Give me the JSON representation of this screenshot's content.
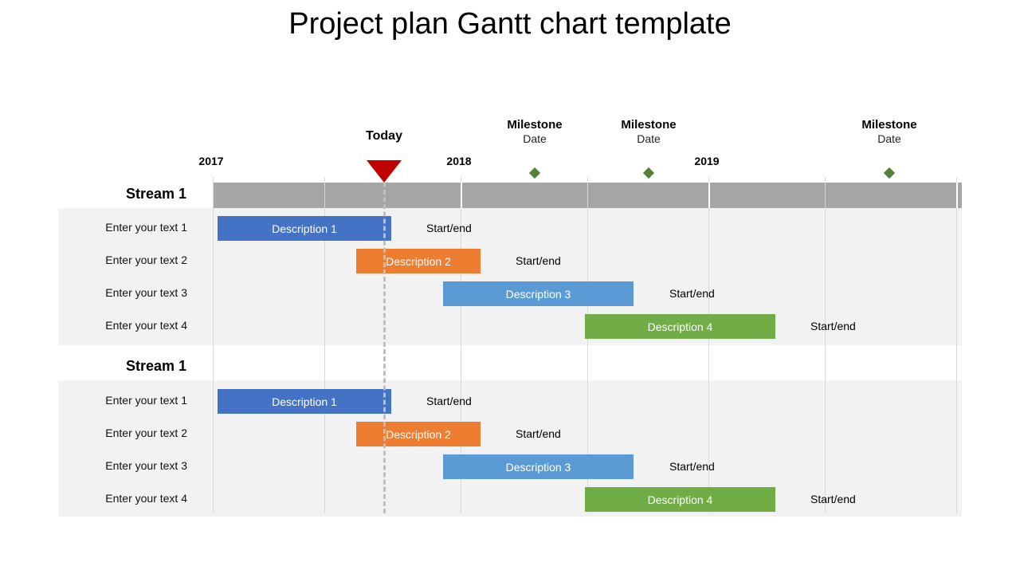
{
  "title": "Project plan Gantt chart template",
  "chart_data": {
    "type": "gantt",
    "title": "Project plan Gantt chart template",
    "x_range": [
      2017.0,
      2020.0
    ],
    "year_ticks": [
      {
        "label": "2017",
        "value": 2017.0
      },
      {
        "label": "2018",
        "value": 2018.0
      },
      {
        "label": "2019",
        "value": 2019.0
      }
    ],
    "gridlines": [
      2017.0,
      2017.45,
      2018.0,
      2018.51,
      2019.0,
      2019.47,
      2020.0
    ],
    "today": {
      "label": "Today",
      "value": 2017.69,
      "color": "#c00000"
    },
    "milestones": [
      {
        "title": "Milestone",
        "subtitle": "Date",
        "value": 2018.3
      },
      {
        "title": "Milestone",
        "subtitle": "Date",
        "value": 2018.76
      },
      {
        "title": "Milestone",
        "subtitle": "Date",
        "value": 2019.73
      }
    ],
    "milestone_color": "#538135",
    "streams": [
      {
        "label": "Stream 1",
        "tasks": [
          {
            "row_label": "Enter your text 1",
            "description": "Description 1",
            "start": 2017.02,
            "end": 2017.72,
            "color": "#4472c4",
            "note": "Start/end"
          },
          {
            "row_label": "Enter your text 2",
            "description": "Description 2",
            "start": 2017.58,
            "end": 2018.08,
            "color": "#ed7d31",
            "note": "Start/end"
          },
          {
            "row_label": "Enter your text 3",
            "description": "Description 3",
            "start": 2017.93,
            "end": 2018.7,
            "color": "#5b9bd5",
            "note": "Start/end"
          },
          {
            "row_label": "Enter your text 4",
            "description": "Description 4",
            "start": 2018.5,
            "end": 2019.27,
            "color": "#70ad47",
            "note": "Start/end"
          }
        ]
      },
      {
        "label": "Stream 1",
        "tasks": [
          {
            "row_label": "Enter your text 1",
            "description": "Description 1",
            "start": 2017.02,
            "end": 2017.72,
            "color": "#4472c4",
            "note": "Start/end"
          },
          {
            "row_label": "Enter your text 2",
            "description": "Description 2",
            "start": 2017.58,
            "end": 2018.08,
            "color": "#ed7d31",
            "note": "Start/end"
          },
          {
            "row_label": "Enter your text 3",
            "description": "Description 3",
            "start": 2017.93,
            "end": 2018.7,
            "color": "#5b9bd5",
            "note": "Start/end"
          },
          {
            "row_label": "Enter your text 4",
            "description": "Description 4",
            "start": 2018.5,
            "end": 2019.27,
            "color": "#70ad47",
            "note": "Start/end"
          }
        ]
      }
    ]
  }
}
